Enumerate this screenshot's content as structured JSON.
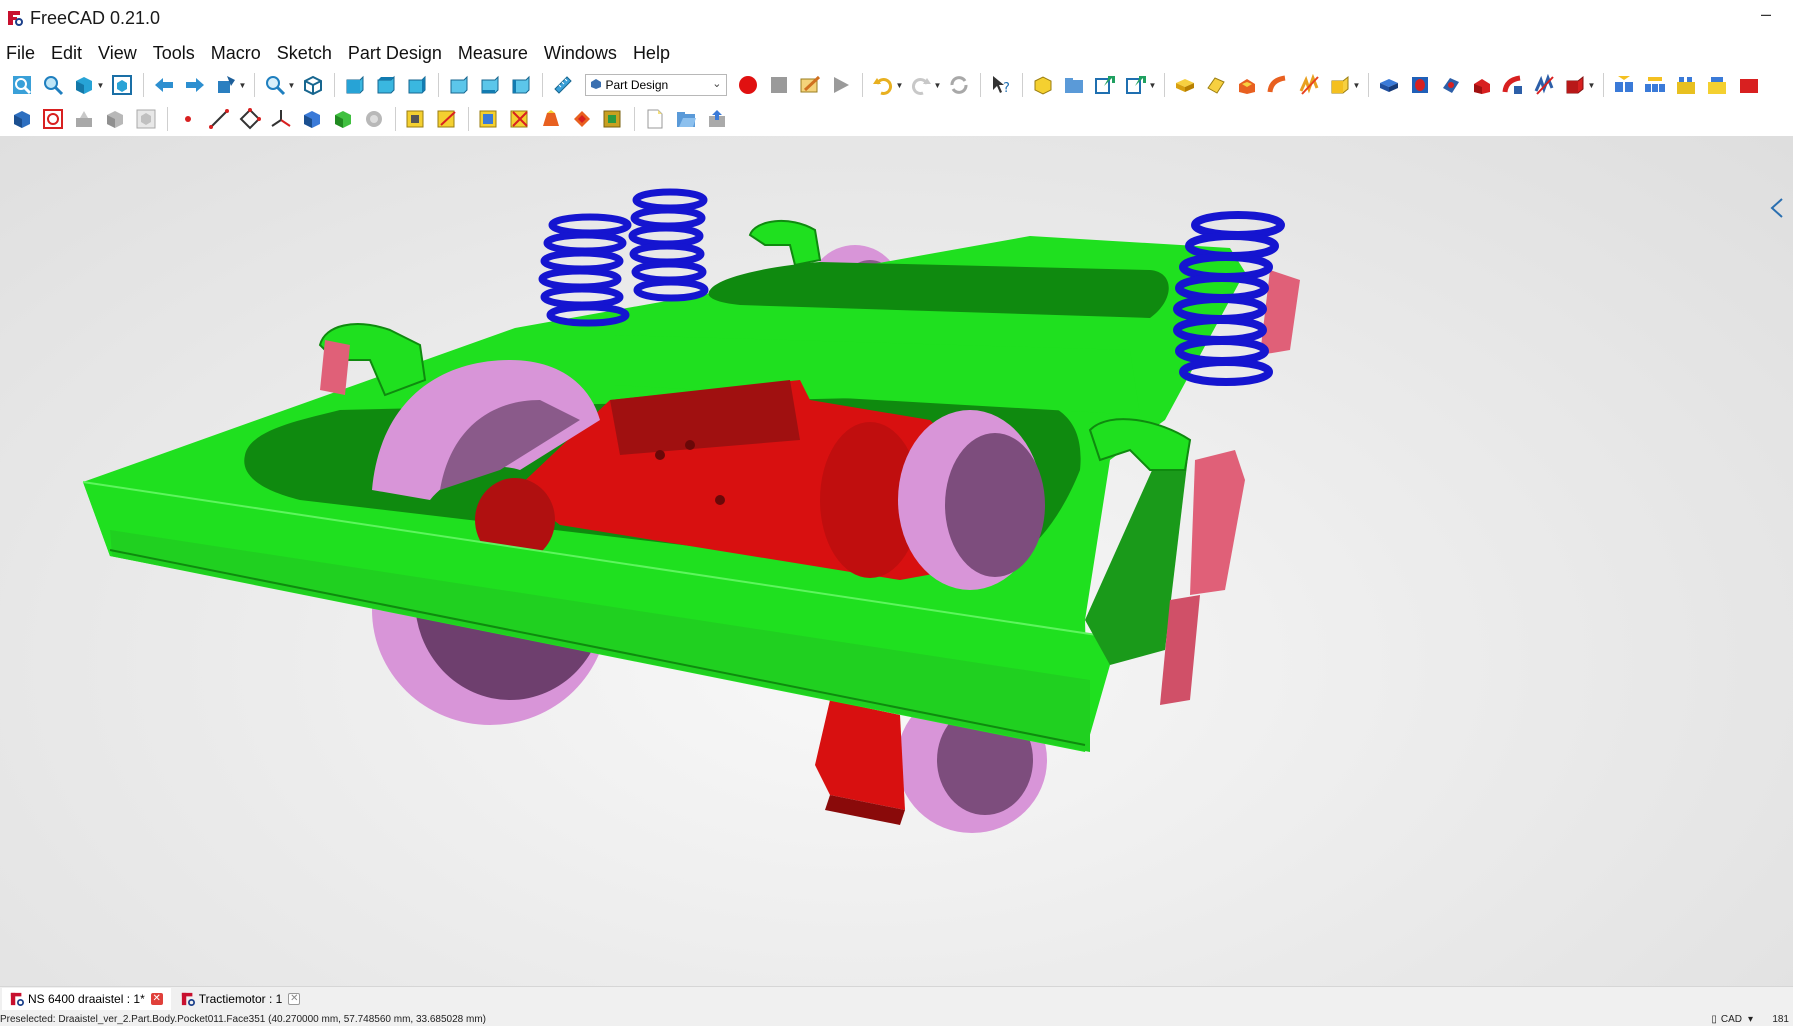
{
  "window": {
    "title": "FreeCAD 0.21.0",
    "minimize_glyph": "–"
  },
  "menu": [
    "File",
    "Edit",
    "View",
    "Tools",
    "Macro",
    "Sketch",
    "Part Design",
    "Measure",
    "Windows",
    "Help"
  ],
  "toolbar": {
    "workbench_selected": "Part Design",
    "row1_icons": [
      "fit-all-icon",
      "fit-selection-icon",
      "draw-style-icon",
      "bounding-box-icon",
      "back-icon",
      "forward-icon",
      "sync-view-icon",
      "view-zoom-icon",
      "isometric-view-icon",
      "front-view-icon",
      "top-view-icon",
      "right-view-icon",
      "rear-view-icon",
      "bottom-view-icon",
      "left-view-icon",
      "measure-distance-icon",
      "macro-record-icon",
      "macro-stop-icon",
      "macro-edit-icon",
      "macro-execute-icon",
      "undo-icon",
      "redo-icon",
      "refresh-icon",
      "whats-this-icon",
      "create-part-icon",
      "create-group-icon",
      "make-link-icon",
      "link-actions-icon",
      "pad-icon",
      "revolution-icon",
      "loft-icon",
      "pipe-icon",
      "helix-icon",
      "additive-primitive-icon",
      "pocket-icon",
      "hole-icon",
      "groove-icon",
      "subtractive-loft-icon",
      "subtractive-pipe-icon",
      "subtractive-helix-icon",
      "subtractive-primitive-icon",
      "mirrored-icon",
      "linear-pattern-icon",
      "polar-pattern-icon",
      "multi-transform-icon",
      "fillet-icon"
    ],
    "row2_icons": [
      "create-body-icon",
      "create-sketch-icon",
      "validate-sketch-icon",
      "shape-binder-icon",
      "clone-icon",
      "datum-point-icon",
      "datum-line-icon",
      "datum-plane-icon",
      "local-cs-icon",
      "sub-shape-binder-icon",
      "shape-binder-green-icon",
      "clone-gray-icon",
      "view-section-icon",
      "attach-sketch-icon",
      "fillet-op-icon",
      "chamfer-icon",
      "draft-icon",
      "thickness-icon",
      "boolean-icon",
      "new-document-icon",
      "open-document-icon",
      "save-document-icon"
    ]
  },
  "colors": {
    "frame": "#1fe01f",
    "frame_dark": "#0f8a0f",
    "motor": "#e01515",
    "motor_dark": "#8a0a0a",
    "springs": "#1515d0",
    "wheels": "#d895d8",
    "wheels_dark": "#6e3f6e",
    "dampers": "#e06078"
  },
  "tabs": [
    {
      "label": "NS 6400 draaistel : 1*",
      "active": true
    },
    {
      "label": "Tractiemotor : 1",
      "active": false
    }
  ],
  "status": {
    "message": "Preselected: Draaistel_ver_2.Part.Body.Pocket011.Face351 (40.270000 mm, 57.748560 mm, 33.685028 mm)",
    "navigation": "CAD",
    "zoom": "181"
  }
}
